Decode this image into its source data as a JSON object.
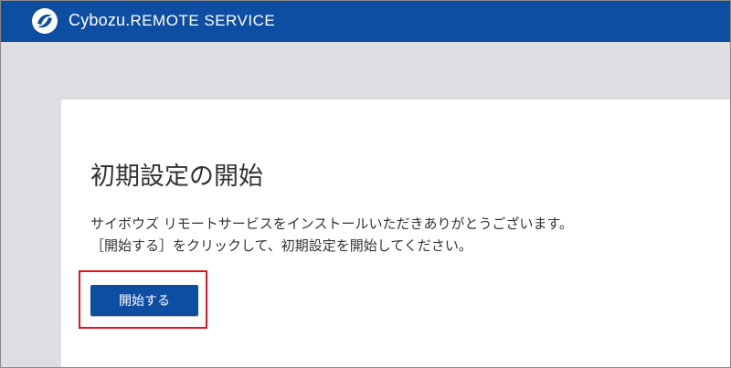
{
  "header": {
    "logo_icon": "cybozu-swirl-logo-icon",
    "brand": "Cybozu.",
    "service": "REMOTE SERVICE",
    "background": "#0d4ea3"
  },
  "main": {
    "title": "初期設定の開始",
    "description_line1": "サイボウズ リモートサービスをインストールいただきありがとうございます。",
    "description_line2": "［開始する］をクリックして、初期設定を開始してください。",
    "start_button_label": "開始する",
    "highlight_color": "#e0141e"
  }
}
